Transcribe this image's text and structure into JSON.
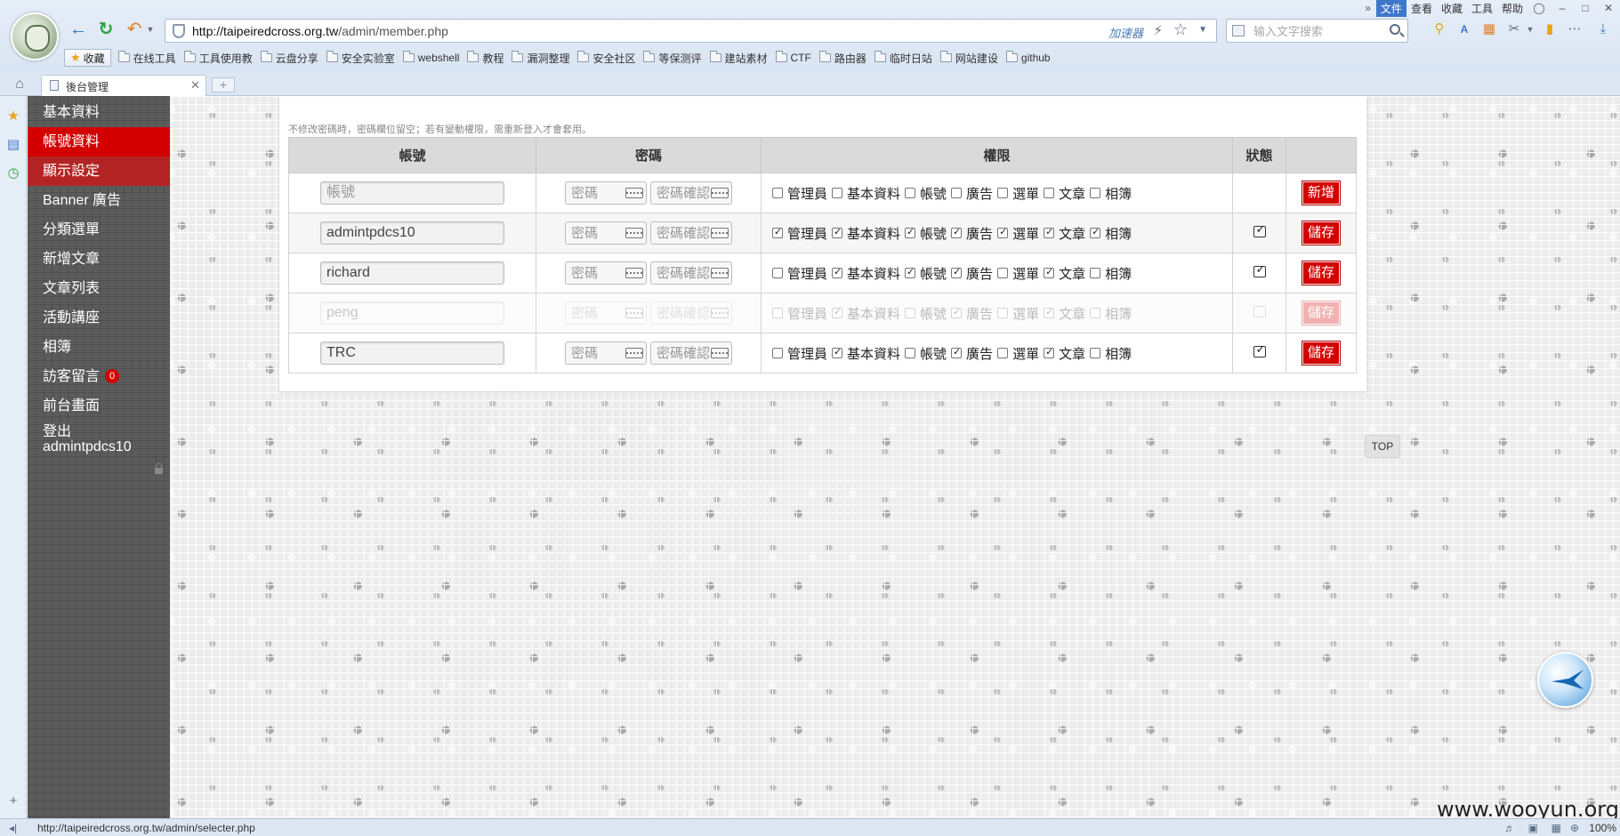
{
  "browser": {
    "url_host": "http://taipeiredcross.org.tw",
    "url_path": "/admin/member.php",
    "accelerator_label": "加速器",
    "search_placeholder": "输入文字搜索",
    "menu": [
      "文件",
      "查看",
      "收藏",
      "工具",
      "帮助"
    ],
    "menu_active": "文件",
    "favorites_label": "收藏",
    "bookmarks": [
      "在线工具",
      "工具使用教",
      "云盘分享",
      "安全实验室",
      "webshell",
      "教程",
      "漏洞整理",
      "安全社区",
      "等保测评",
      "建站素材",
      "CTF",
      "路由器",
      "临时日站",
      "网站建设",
      "github"
    ],
    "tab_label": "後台管理",
    "status_url": "http://taipeiredcross.org.tw/admin/selecter.php",
    "zoom": "100%"
  },
  "sidebar": {
    "items": [
      {
        "label": "基本資料",
        "state": "normal"
      },
      {
        "label": "帳號資料",
        "state": "active"
      },
      {
        "label": "顯示設定",
        "state": "semi"
      },
      {
        "label": "Banner 廣告",
        "state": "normal"
      },
      {
        "label": "分類選單",
        "state": "normal"
      },
      {
        "label": "新增文章",
        "state": "normal"
      },
      {
        "label": "文章列表",
        "state": "normal"
      },
      {
        "label": "活動講座",
        "state": "normal"
      },
      {
        "label": "相簿",
        "state": "normal"
      },
      {
        "label": "訪客留言",
        "state": "normal",
        "badge": "0"
      },
      {
        "label": "前台畫面",
        "state": "normal"
      }
    ],
    "logout_label": "登出",
    "logout_user": "admintpdcs10"
  },
  "main": {
    "notice": "不修改密碼時，密碼欄位留空；若有變動權限，需重新登入才會套用。",
    "headers": {
      "account": "帳號",
      "password": "密碼",
      "permissions": "權限",
      "status": "狀態"
    },
    "permission_labels": [
      "管理員",
      "基本資料",
      "帳號",
      "廣告",
      "選單",
      "文章",
      "相簿"
    ],
    "account_placeholder": "帳號",
    "password_placeholder": "密碼",
    "password_confirm_placeholder": "密碼確認",
    "rows": [
      {
        "account": "",
        "perms": [
          false,
          false,
          false,
          false,
          false,
          false,
          false
        ],
        "status": "none",
        "button": "新增",
        "disabled": false
      },
      {
        "account": "admintpdcs10",
        "perms": [
          true,
          true,
          true,
          true,
          true,
          true,
          true
        ],
        "status": "checked",
        "button": "儲存",
        "disabled": false
      },
      {
        "account": "richard",
        "perms": [
          false,
          true,
          true,
          true,
          false,
          true,
          false
        ],
        "status": "checked",
        "button": "儲存",
        "disabled": false
      },
      {
        "account": "peng",
        "perms": [
          false,
          true,
          false,
          true,
          false,
          true,
          false
        ],
        "status": "unchecked",
        "button": "儲存",
        "disabled": true
      },
      {
        "account": "TRC",
        "perms": [
          false,
          true,
          false,
          true,
          false,
          true,
          false
        ],
        "status": "checked",
        "button": "儲存",
        "disabled": false
      }
    ],
    "top_button": "TOP"
  },
  "watermark": "www.wooyun.org",
  "colors": {
    "accent_red": "#d40000",
    "sidebar_bg": "#5b5b5b",
    "browser_blue": "#3f78c9"
  }
}
